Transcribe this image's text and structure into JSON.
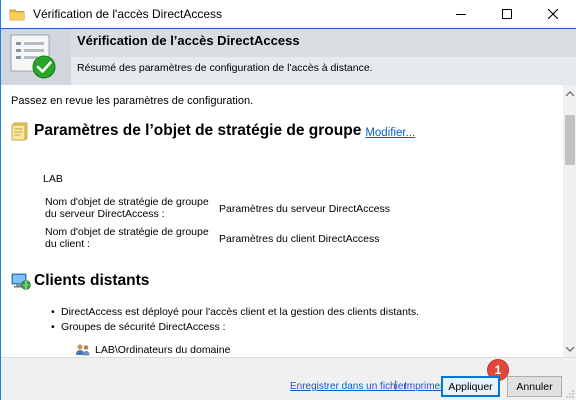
{
  "window": {
    "title": "Vérification de l'accès DirectAccess",
    "buttons": {
      "minimize": "—",
      "maximize": "☐",
      "close": "✕"
    }
  },
  "banner": {
    "title": "Vérification de l’accès DirectAccess",
    "subtitle": "Résumé des paramètres de configuration de l'accès à distance."
  },
  "content": {
    "intro": "Passez en revue les paramètres de configuration.",
    "gpo_section": {
      "title": "Paramètres de l’objet de stratégie de groupe",
      "modify_link": "Modifier...",
      "domain": "LAB",
      "rows": [
        {
          "label": "Nom d'objet de stratégie de groupe du serveur DirectAccess :",
          "value": "Paramètres du serveur DirectAccess"
        },
        {
          "label": "Nom d'objet de stratégie de groupe du client :",
          "value": "Paramètres du client DirectAccess"
        }
      ]
    },
    "clients_section": {
      "title": "Clients distants",
      "bullets": [
        "DirectAccess est déployé pour l'accès client et la gestion des clients distants.",
        "Groupes de sécurité DirectAccess :"
      ],
      "group": "LAB\\Ordinateurs du domaine"
    }
  },
  "footer": {
    "save_link": "Enregistrer dans un fichier",
    "separator": "|",
    "print_link": "Imprimer",
    "apply_button": "Appliquer",
    "cancel_button": "Annuler",
    "badge": "1"
  },
  "icons": {
    "app": "folder-icon",
    "banner": "checklist-checkmark-icon",
    "gpo": "policy-scroll-icon",
    "clients": "computer-globe-icon",
    "group": "users-group-icon"
  },
  "colors": {
    "banner_accent": "#2e79c9",
    "link": "#0b5fc7",
    "badge": "#e2473d",
    "check_green": "#2aa52a"
  }
}
